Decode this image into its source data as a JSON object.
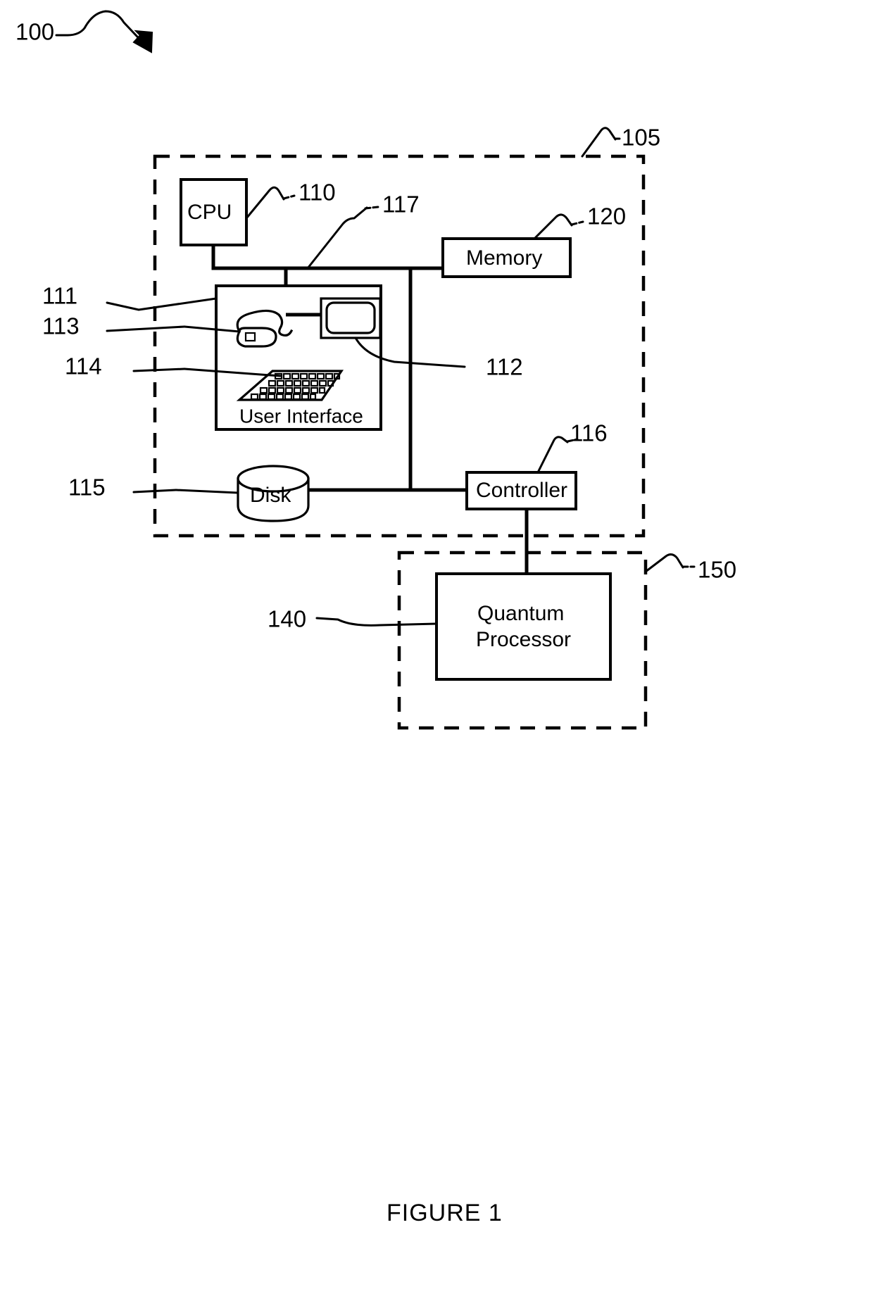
{
  "figure": {
    "caption": "FIGURE 1",
    "system_ref": "100"
  },
  "reference_numerals": {
    "system": "100",
    "digital_computer": "105",
    "cpu": "110",
    "user_interface": "111",
    "display": "112",
    "mouse": "113",
    "keyboard": "114",
    "disk": "115",
    "controller": "116",
    "bus": "117",
    "memory": "120",
    "quantum_processor": "140",
    "quantum_subsystem": "150"
  },
  "blocks": {
    "cpu": {
      "label": "CPU",
      "ref": "110"
    },
    "memory": {
      "label": "Memory",
      "ref": "120"
    },
    "user_interface": {
      "label": "User Interface",
      "ref": "111"
    },
    "disk": {
      "label": "Disk",
      "ref": "115"
    },
    "controller": {
      "label": "Controller",
      "ref": "116"
    },
    "quantum_processor": {
      "label": "Quantum\nProcessor",
      "line1": "Quantum",
      "line2": "Processor",
      "ref": "140"
    }
  },
  "icons": {
    "mouse": {
      "name": "mouse-icon",
      "ref": "113"
    },
    "monitor": {
      "name": "monitor-icon",
      "ref": "112"
    },
    "keyboard": {
      "name": "keyboard-icon",
      "ref": "114"
    },
    "disk_cylinder": {
      "name": "disk-cylinder-icon"
    },
    "arrow": {
      "name": "arrow-icon"
    }
  },
  "enclosures": {
    "digital_computer": {
      "ref": "105",
      "style": "dashed"
    },
    "quantum_subsystem": {
      "ref": "150",
      "style": "dashed"
    }
  },
  "colors": {
    "line": "#000000",
    "background": "#ffffff"
  }
}
